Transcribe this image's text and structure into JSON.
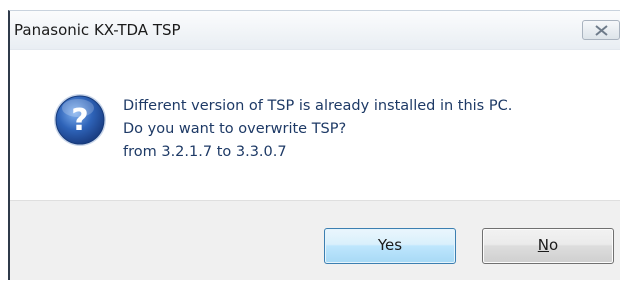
{
  "window": {
    "title": "Panasonic KX-TDA TSP"
  },
  "icons": {
    "message_icon": "question-icon",
    "close": "close-icon"
  },
  "message": {
    "line1": "Different version of TSP is already installed in this PC.",
    "line2": "Do you want to overwrite TSP?",
    "line3": "from 3.2.1.7 to 3.3.0.7"
  },
  "buttons": {
    "yes_label": "Yes",
    "no_accel": "N",
    "no_rest": "o"
  },
  "colors": {
    "message_text": "#1e3a66",
    "icon_blue": "#2a5fb0",
    "default_button_border": "#3c7fb1"
  }
}
